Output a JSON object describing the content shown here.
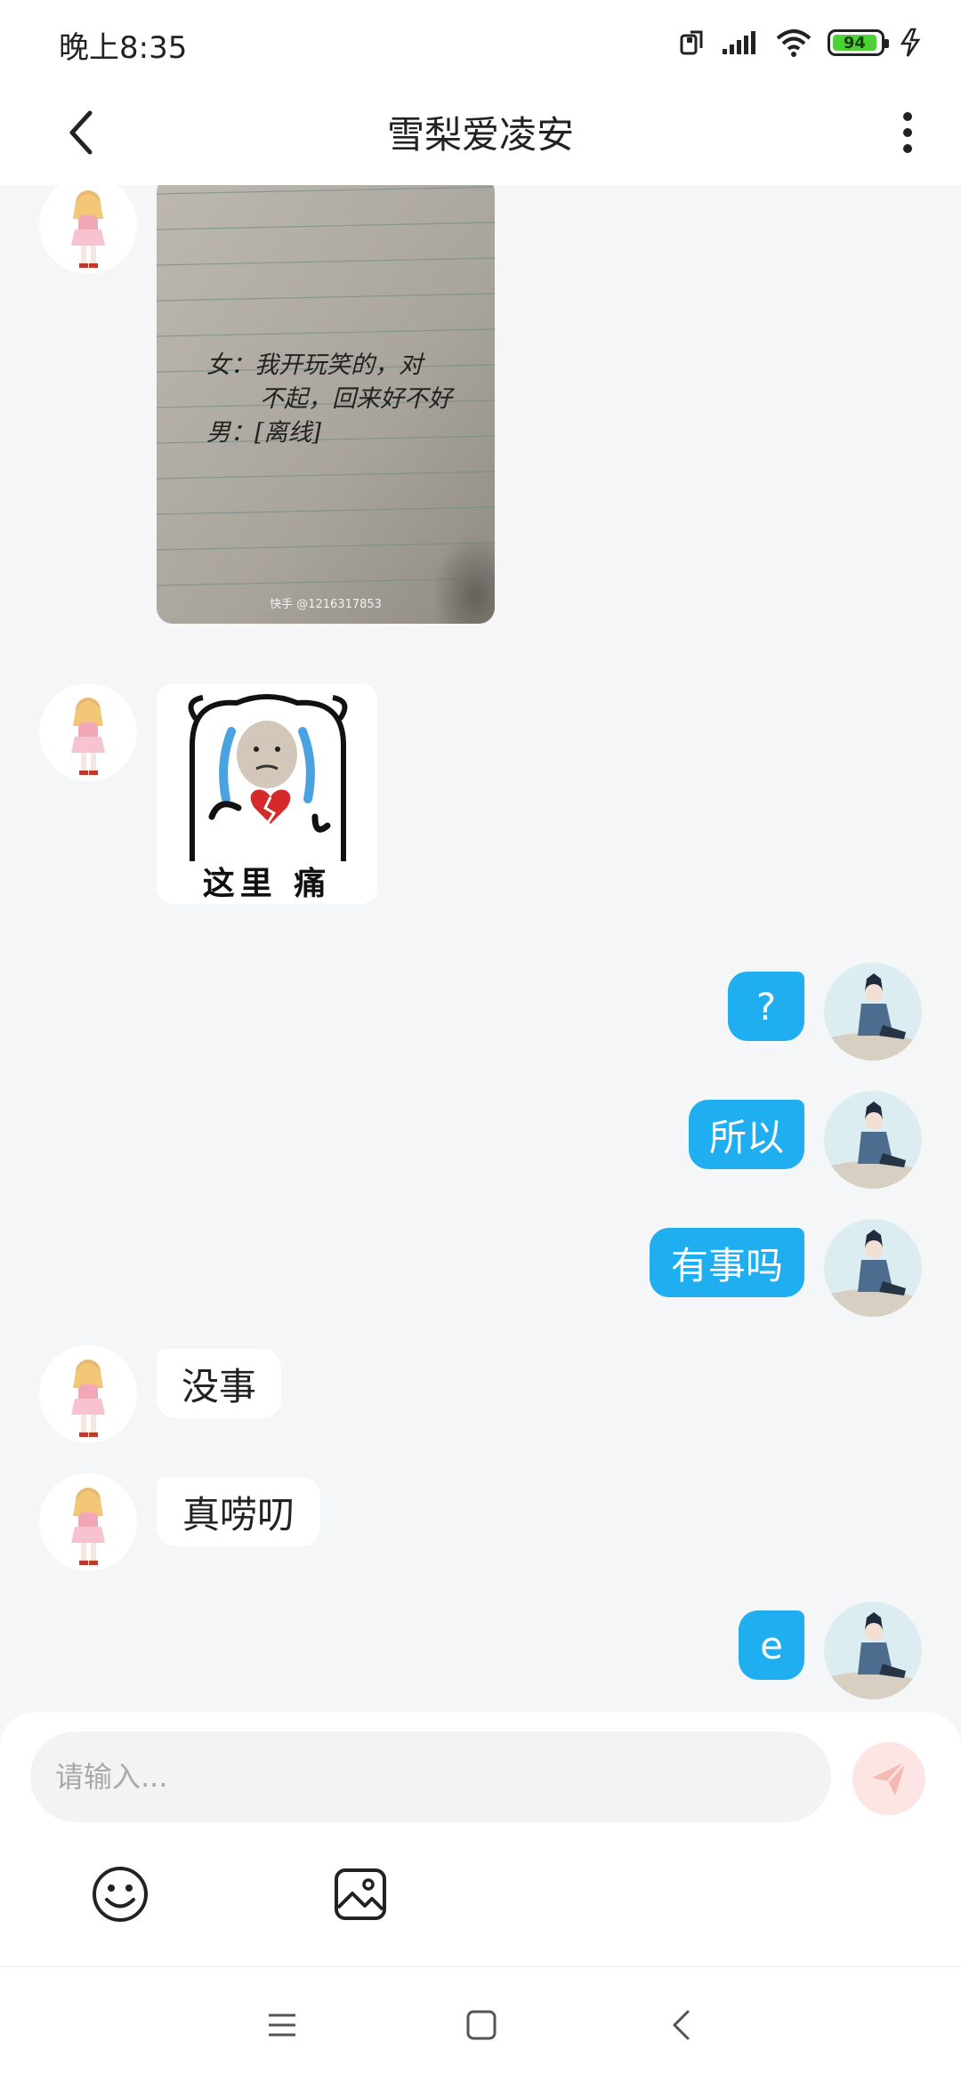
{
  "status_bar": {
    "time": "晚上8:35",
    "battery_level": "94",
    "icons": [
      "screen-rotate-icon",
      "signal-icon",
      "wifi-icon",
      "battery-icon",
      "charging-icon"
    ]
  },
  "header": {
    "title": "雪梨爱凌安",
    "back_icon": "chevron-left-icon",
    "more_icon": "more-vertical-icon"
  },
  "photo_message": {
    "line1": "女：我开玩笑的，对",
    "line2": "不起，回来好不好",
    "line3": "男：[离线]",
    "watermark": "快手 @1216317853"
  },
  "sticker_message": {
    "caption": "这里 痛"
  },
  "messages": [
    {
      "side": "out",
      "text": "?"
    },
    {
      "side": "out",
      "text": "所以"
    },
    {
      "side": "out",
      "text": "有事吗"
    },
    {
      "side": "in",
      "text": "没事"
    },
    {
      "side": "in",
      "text": "真唠叨"
    },
    {
      "side": "out",
      "text": "e"
    }
  ],
  "input": {
    "placeholder": "请输入..."
  },
  "toolbar": {
    "emoji_icon": "smiley-icon",
    "image_icon": "image-icon",
    "send_icon": "send-icon"
  },
  "nav_bar": {
    "icons": [
      "menu-icon",
      "home-square-icon",
      "back-icon"
    ]
  },
  "colors": {
    "outgoing_bubble": "#1faef0",
    "incoming_bubble": "#ffffff",
    "chat_background": "#f4f6f8",
    "battery_fill": "#4cd137",
    "send_button": "#fde5e3"
  }
}
